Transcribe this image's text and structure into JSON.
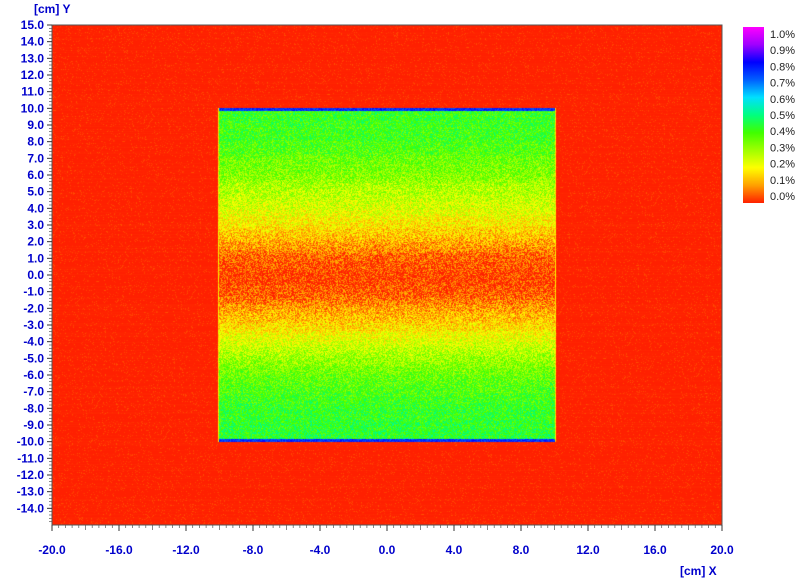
{
  "chart_data": {
    "type": "heatmap",
    "x_axis_label": "[cm] X",
    "y_axis_label": "[cm] Y",
    "xlim": [
      -20.0,
      20.0
    ],
    "ylim": [
      -15.0,
      15.0
    ],
    "x_ticks": [
      -20.0,
      -16.0,
      -12.0,
      -8.0,
      -4.0,
      0.0,
      4.0,
      8.0,
      12.0,
      16.0,
      20.0
    ],
    "x_tick_labels": [
      "-20.0",
      "-16.0",
      "-12.0",
      "-8.0",
      "-4.0",
      "0.0",
      "4.0",
      "8.0",
      "12.0",
      "16.0",
      "20.0"
    ],
    "y_ticks": [
      15,
      14,
      13,
      12,
      11,
      10,
      9,
      8,
      7,
      6,
      5,
      4,
      3,
      2,
      1,
      0,
      -1,
      -2,
      -3,
      -4,
      -5,
      -6,
      -7,
      -8,
      -9,
      -10,
      -11,
      -12,
      -13,
      -14
    ],
    "y_tick_labels": [
      "15.0",
      "14.0",
      "13.0",
      "12.0",
      "11.0",
      "10.0",
      "9.0",
      "8.0",
      "7.0",
      "6.0",
      "5.0",
      "4.0",
      "3.0",
      "2.0",
      "1.0",
      "0.0",
      "-1.0",
      "-2.0",
      "-3.0",
      "-4.0",
      "-5.0",
      "-6.0",
      "-7.0",
      "-8.0",
      "-9.0",
      "-10.0",
      "-11.0",
      "-12.0",
      "-13.0",
      "-14.0"
    ],
    "colorbar": {
      "labels": [
        "1.0%",
        "0.9%",
        "0.8%",
        "0.7%",
        "0.6%",
        "0.5%",
        "0.4%",
        "0.3%",
        "0.2%",
        "0.1%",
        "0.0%"
      ],
      "values": [
        1.0,
        0.9,
        0.8,
        0.7,
        0.6,
        0.5,
        0.4,
        0.3,
        0.2,
        0.1,
        0.0
      ],
      "colors": [
        "#ff00ff",
        "#a000ff",
        "#0000ff",
        "#0060ff",
        "#00e0ff",
        "#00ff80",
        "#40ff00",
        "#a0ff00",
        "#ffff00",
        "#ffa000",
        "#ff2000"
      ]
    },
    "field": {
      "background_value": 0.0,
      "square_x": [
        -10.0,
        10.0
      ],
      "square_y": [
        -10.0,
        10.0
      ],
      "row_profile_y": [
        10.0,
        8.0,
        6.0,
        5.0,
        4.0,
        3.0,
        2.0,
        1.0,
        0.0,
        -1.0,
        -2.0,
        -3.0,
        -4.0,
        -5.0,
        -6.0,
        -8.0,
        -10.0
      ],
      "row_profile_value": [
        0.42,
        0.4,
        0.33,
        0.28,
        0.24,
        0.18,
        0.12,
        0.05,
        0.02,
        0.04,
        0.1,
        0.16,
        0.24,
        0.3,
        0.36,
        0.42,
        0.44
      ],
      "edge_value": 0.75,
      "noise": 0.09
    }
  }
}
